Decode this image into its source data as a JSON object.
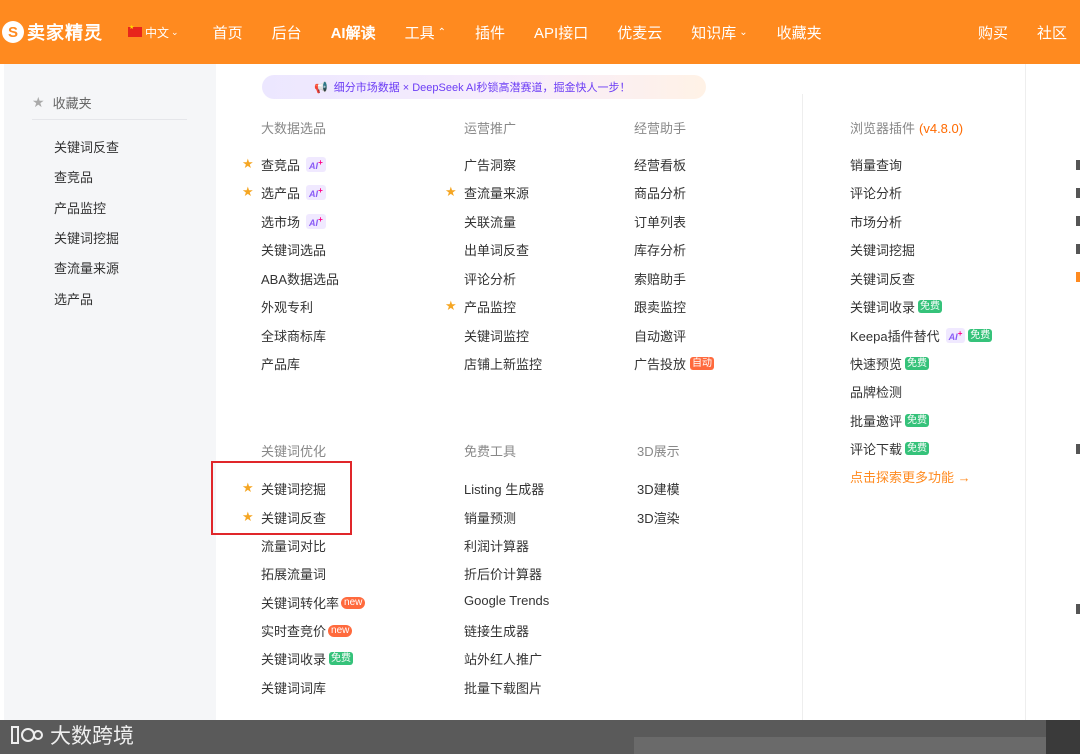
{
  "brand": {
    "name": "卖家精灵"
  },
  "lang": "中文",
  "nav": [
    "首页",
    "后台",
    "AI解读",
    "工具",
    "插件",
    "API接口",
    "优麦云",
    "知识库",
    "收藏夹"
  ],
  "nav_right": [
    "购买",
    "社区"
  ],
  "favorites": {
    "title": "收藏夹",
    "items": [
      "关键词反查",
      "查竞品",
      "产品监控",
      "关键词挖掘",
      "查流量来源",
      "选产品"
    ]
  },
  "promo": "细分市场数据 × DeepSeek AI秒锁高潜赛道，掘金快人一步！",
  "col_bigdata": {
    "title": "大数据选品",
    "items": [
      "查竞品",
      "选产品",
      "选市场",
      "关键词选品",
      "ABA数据选品",
      "外观专利",
      "全球商标库",
      "产品库"
    ]
  },
  "col_ops": {
    "title": "运营推广",
    "items": [
      "广告洞察",
      "查流量来源",
      "关联流量",
      "出单词反查",
      "评论分析",
      "产品监控",
      "关键词监控",
      "店铺上新监控"
    ]
  },
  "col_biz": {
    "title": "经营助手",
    "items": [
      "经营看板",
      "商品分析",
      "订单列表",
      "库存分析",
      "索赔助手",
      "跟卖监控",
      "自动邀评",
      "广告投放"
    ]
  },
  "col_plugin": {
    "title": "浏览器插件",
    "version": "(v4.8.0)",
    "items": [
      "销量查询",
      "评论分析",
      "市场分析",
      "关键词挖掘",
      "关键词反查",
      "关键词收录",
      "Keepa插件替代",
      "快速预览",
      "品牌检测",
      "批量邀评",
      "评论下载"
    ],
    "more": "点击探索更多功能 →"
  },
  "col_kw": {
    "title": "关键词优化",
    "items": [
      "关键词挖掘",
      "关键词反查",
      "流量词对比",
      "拓展流量词",
      "关键词转化率",
      "实时查竞价",
      "关键词收录",
      "关键词词库"
    ]
  },
  "col_free": {
    "title": "免费工具",
    "items": [
      "Listing 生成器",
      "销量预测",
      "利润计算器",
      "折后价计算器",
      "Google Trends",
      "链接生成器",
      "站外红人推广",
      "批量下载图片"
    ]
  },
  "col_3d": {
    "title": "3D展示",
    "items": [
      "3D建模",
      "3D渲染"
    ]
  },
  "badges": {
    "ai": "AI",
    "free": "免费",
    "new": "new",
    "auto": "自动"
  },
  "watermark": "大数跨境",
  "colors": {
    "brand": "#ff8a1f",
    "highlight_box": "#e0262a",
    "free": "#35c27a",
    "new": "#ff6a3d"
  }
}
